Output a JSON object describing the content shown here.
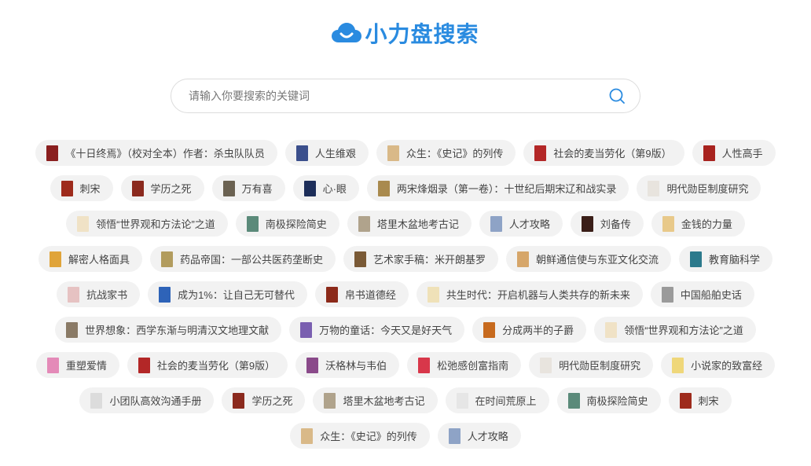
{
  "brand": {
    "title": "小力盘搜索",
    "color": "#2a8be0"
  },
  "search": {
    "placeholder": "请输入你要搜索的关键词",
    "icon": "search-icon"
  },
  "book_rows": [
    [
      {
        "title": "《十日终焉》（校对全本）作者：杀虫队队员",
        "cover_color": "#8a1f1f"
      },
      {
        "title": "人生维艰",
        "cover_color": "#3b4f8c"
      },
      {
        "title": "众生：《史记》的列传",
        "cover_color": "#d9b988"
      },
      {
        "title": "社会的麦当劳化（第9版）",
        "cover_color": "#b32727"
      },
      {
        "title": "人性高手",
        "cover_color": "#a8231f"
      }
    ],
    [
      {
        "title": "刺宋",
        "cover_color": "#9e2b1c"
      },
      {
        "title": "学历之死",
        "cover_color": "#8b2a1e"
      },
      {
        "title": "万有喜",
        "cover_color": "#6b6252"
      },
      {
        "title": "心·眼",
        "cover_color": "#1d2e5a"
      },
      {
        "title": "两宋烽烟录（第一卷）：十世纪后期宋辽和战实录",
        "cover_color": "#a98a4e"
      },
      {
        "title": "明代勋臣制度研究",
        "cover_color": "#e8e4de"
      }
    ],
    [
      {
        "title": "领悟“世界观和方法论”之道",
        "cover_color": "#f0e2c6"
      },
      {
        "title": "南极探险简史",
        "cover_color": "#5b8a7a"
      },
      {
        "title": "塔里木盆地考古记",
        "cover_color": "#b0a38c"
      },
      {
        "title": "人才攻略",
        "cover_color": "#8ea3c6"
      },
      {
        "title": "刘备传",
        "cover_color": "#3a1e18"
      },
      {
        "title": "金钱的力量",
        "cover_color": "#e8c98a"
      }
    ],
    [
      {
        "title": "解密人格面具",
        "cover_color": "#e0a43a"
      },
      {
        "title": "药品帝国：一部公共医药垄断史",
        "cover_color": "#b29c5e"
      },
      {
        "title": "艺术家手稿：米开朗基罗",
        "cover_color": "#7a5a36"
      },
      {
        "title": "朝鲜通信使与东亚文化交流",
        "cover_color": "#d6a66a"
      },
      {
        "title": "教育脑科学",
        "cover_color": "#2c7a8c"
      }
    ],
    [
      {
        "title": "抗战家书",
        "cover_color": "#e6c2c2"
      },
      {
        "title": "成为1%：让自己无可替代",
        "cover_color": "#2e63b8"
      },
      {
        "title": "帛书道德经",
        "cover_color": "#8c2a1a"
      },
      {
        "title": "共生时代：开启机器与人类共存的新未来",
        "cover_color": "#efe1b8"
      },
      {
        "title": "中国船舶史话",
        "cover_color": "#9a9a9a"
      }
    ],
    [
      {
        "title": "世界想象：西学东渐与明清汉文地理文献",
        "cover_color": "#8a7a66"
      },
      {
        "title": "万物的童话：今天又是好天气",
        "cover_color": "#7a5fb0"
      },
      {
        "title": "分成两半的子爵",
        "cover_color": "#c76a1e"
      },
      {
        "title": "领悟“世界观和方法论”之道",
        "cover_color": "#f0e2c6"
      }
    ],
    [
      {
        "title": "重塑爱情",
        "cover_color": "#e48ab8"
      },
      {
        "title": "社会的麦当劳化（第9版）",
        "cover_color": "#b32727"
      },
      {
        "title": "沃格林与韦伯",
        "cover_color": "#8a4a8a"
      },
      {
        "title": "松弛感创富指南",
        "cover_color": "#d8374a"
      },
      {
        "title": "明代勋臣制度研究",
        "cover_color": "#e8e4de"
      },
      {
        "title": "小说家的致富经",
        "cover_color": "#efd77a"
      }
    ],
    [
      {
        "title": "小团队高效沟通手册",
        "cover_color": "#dcdcdc"
      },
      {
        "title": "学历之死",
        "cover_color": "#8b2a1e"
      },
      {
        "title": "塔里木盆地考古记",
        "cover_color": "#b0a38c"
      },
      {
        "title": "在时间荒原上",
        "cover_color": "#e6e6e6"
      },
      {
        "title": "南极探险简史",
        "cover_color": "#5b8a7a"
      },
      {
        "title": "刺宋",
        "cover_color": "#9e2b1c"
      }
    ],
    [
      {
        "title": "众生：《史记》的列传",
        "cover_color": "#d9b988"
      },
      {
        "title": "人才攻略",
        "cover_color": "#8ea3c6"
      }
    ]
  ]
}
